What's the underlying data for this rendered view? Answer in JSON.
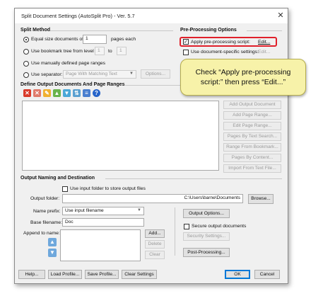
{
  "window": {
    "title": "Split Document Settings (AutoSplit Pro) - Ver. 5.7",
    "close_glyph": "✕"
  },
  "split_method": {
    "title": "Split Method",
    "equal_size": {
      "label_before": "Equal size documents of",
      "value": "1",
      "label_after": "pages each"
    },
    "bookmark": {
      "label": "Use bookmark tree from level",
      "from": "1",
      "to_label": "to",
      "to": "1"
    },
    "manual": {
      "label": "Use manually defined page ranges"
    },
    "separator": {
      "label": "Use separator:",
      "selected": "Page With Matching Text",
      "options_button": "Options..."
    }
  },
  "preprocessing": {
    "title": "Pre-Processing Options",
    "apply": {
      "label": "Apply pre-processing script:",
      "edit": "Edit..."
    },
    "doc_specific": {
      "label": "Use document-specific settings:",
      "edit": "Edit..."
    }
  },
  "callout": {
    "line1": "Check “Apply pre-processing",
    "line2": "script:” then press “Edit...”"
  },
  "define_output": {
    "title": "Define Output Documents And Page Ranges",
    "buttons": [
      "Add Output Document",
      "Add Page Range...",
      "Edit Page Range...",
      "Pages By Text Search...",
      "Range From Bookmark...",
      "Pages By Content...",
      "Import From Text File..."
    ]
  },
  "naming": {
    "title": "Output Naming and Destination",
    "use_input_folder": "Use input folder to store output files",
    "output_folder": {
      "label": "Output folder:",
      "value": "C:\\Users\\barne\\Documents",
      "browse": "Browse..."
    },
    "name_prefix": {
      "label": "Name prefix:",
      "value": "Use input filename"
    },
    "base_filename": {
      "label": "Base filename:",
      "value": "Doc"
    },
    "append_to_name": {
      "label": "Append to name:",
      "add": "Add...",
      "delete": "Delete",
      "clear": "Clear"
    },
    "output_options": "Output Options...",
    "secure": {
      "label": "Secure output documents",
      "button": "Security Settings..."
    },
    "post_processing": "Post-Processing..."
  },
  "footer": {
    "help": "Help...",
    "load": "Load Profile...",
    "save": "Save Profile...",
    "clear": "Clear Settings",
    "ok": "OK",
    "cancel": "Cancel"
  },
  "colors": {
    "highlight": "#e0202a",
    "callout": "#f7f2a9",
    "accent": "#0078d7"
  }
}
